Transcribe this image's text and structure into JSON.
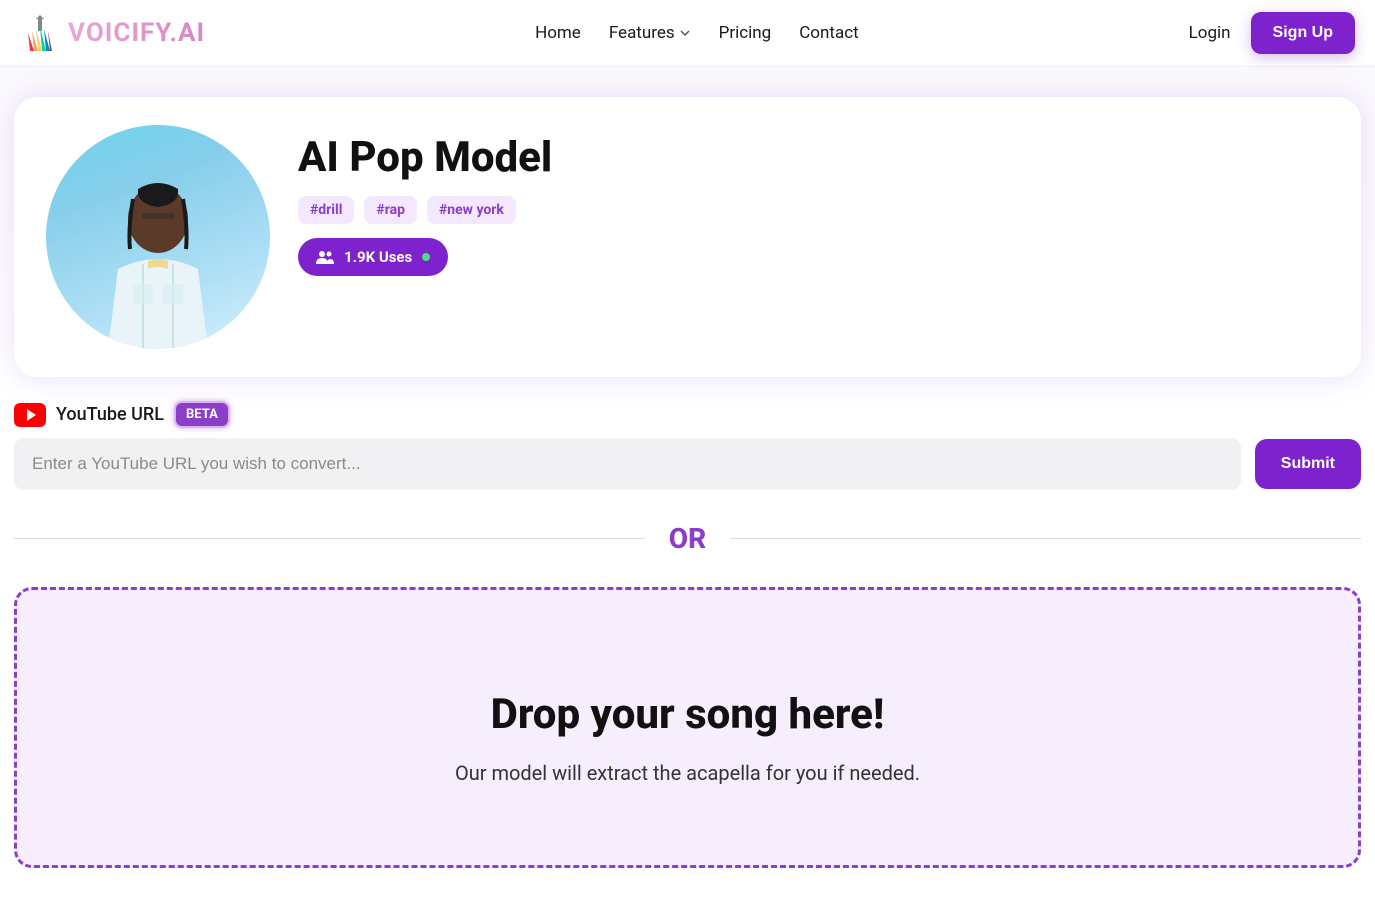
{
  "brand": "VOICIFY.AI",
  "nav": {
    "home": "Home",
    "features": "Features",
    "pricing": "Pricing",
    "contact": "Contact"
  },
  "auth": {
    "login": "Login",
    "signup": "Sign Up"
  },
  "model": {
    "title": "AI Pop Model",
    "tags": [
      "#drill",
      "#rap",
      "#new york"
    ],
    "uses_label": "1.9K Uses"
  },
  "youtube": {
    "label": "YouTube URL",
    "beta": "BETA",
    "placeholder": "Enter a YouTube URL you wish to convert...",
    "submit": "Submit"
  },
  "divider": "OR",
  "dropzone": {
    "title": "Drop your song here!",
    "subtitle": "Our model will extract the acapella for you if needed."
  }
}
